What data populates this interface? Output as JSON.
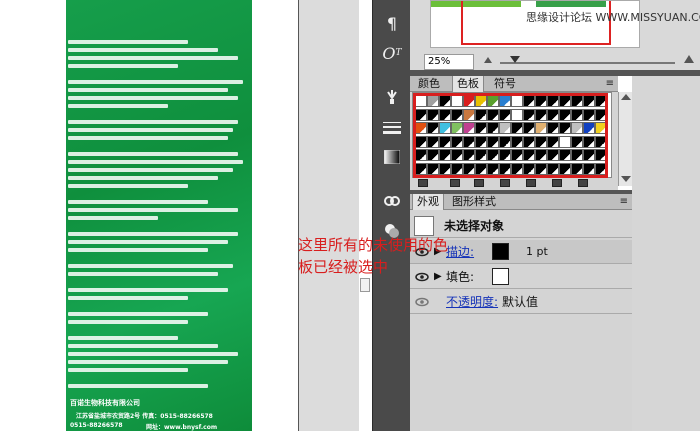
{
  "document": {
    "company": "百诺生物科技有限公司",
    "address": "江苏省盐城市农贸路2号   传真：0515-88266578",
    "phone": "0515-88266578",
    "website": "网址：www.bnysf.com"
  },
  "watermark": "思缘设计论坛  WWW.MISSYUAN.COM",
  "zoom": {
    "value": "25%"
  },
  "swatches": {
    "tabs": [
      "颜色",
      "色板",
      "符号"
    ],
    "active_tab": "色板",
    "colors": [
      [
        "#ffffff",
        "#a0a0a0",
        "#000000",
        "#ffffff",
        "#d81e1e",
        "#e8c000",
        "#5aa02c",
        "#2a7fd0",
        "#ffffff",
        "#000000",
        "#000000",
        "#000000",
        "#000000",
        "#000000",
        "#000000",
        "#000000"
      ],
      [
        "#000000",
        "#000000",
        "#000000",
        "#000000",
        "#c87840",
        "#000000",
        "#000000",
        "#000000",
        "#ffffff",
        "#000000",
        "#000000",
        "#000000",
        "#000000",
        "#000000",
        "#000000",
        "#000000"
      ],
      [
        "#e05010",
        "#000000",
        "#40c0e0",
        "#80c060",
        "#c04090",
        "#000000",
        "#000000",
        "#c0c0c0",
        "#000000",
        "#000000",
        "#e0b070",
        "#000000",
        "#000000",
        "#c0c0c0",
        "#1040c0",
        "#f0d020"
      ],
      [
        "#000000",
        "#000000",
        "#000000",
        "#000000",
        "#000000",
        "#000000",
        "#000000",
        "#000000",
        "#000000",
        "#000000",
        "#000000",
        "#000000",
        "#ffffff",
        "#000000",
        "#000000",
        "#000000"
      ],
      [
        "#000000",
        "#000000",
        "#000000",
        "#000000",
        "#000000",
        "#000000",
        "#000000",
        "#000000",
        "#000000",
        "#000000",
        "#000000",
        "#000000",
        "#000000",
        "#000000",
        "#000000",
        "#000000"
      ],
      [
        "#000000",
        "#000000",
        "#000000",
        "#000000",
        "#000000",
        "#000000",
        "#000000",
        "#000000",
        "#000000",
        "#000000",
        "#000000",
        "#000000",
        "#000000",
        "#000000",
        "#000000",
        "#000000"
      ]
    ]
  },
  "appearance": {
    "tabs": [
      "外观",
      "图形样式"
    ],
    "active_tab": "外观",
    "header": "未选择对象",
    "stroke_label": "描边:",
    "stroke_weight": "1 pt",
    "fill_label": "填色:",
    "opacity_label": "不透明度:",
    "opacity_value": "默认值"
  },
  "annotation": "这里所有的未使用的色板已经被选中",
  "colors": {
    "accent_red": "#d81e1e",
    "panel_bg": "#d4d4d4",
    "tool_bg": "#4a4a4a",
    "doc_green": "#169e4b"
  }
}
